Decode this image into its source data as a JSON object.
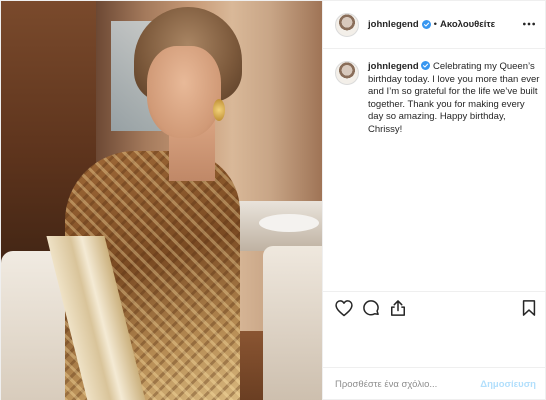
{
  "header": {
    "username": "johnlegend",
    "follow_label": "Ακολουθείτε"
  },
  "caption": {
    "username": "johnlegend",
    "text": "Celebrating my Queen’s birthday today. I love you more than ever and I’m so grateful for the life we’ve built together. Thank you for making every day so amazing. Happy birthday, Chrissy!"
  },
  "actions": {
    "icons": [
      "heart-icon",
      "comment-icon",
      "share-icon",
      "bookmark-icon"
    ],
    "more_icon": "more-options-icon"
  },
  "comment": {
    "placeholder": "Προσθέστε ένα σχόλιο...",
    "post_label": "Δημοσίευση"
  },
  "colors": {
    "verified": "#3897f0",
    "post_disabled": "#b2dffc",
    "text": "#262626",
    "muted": "#8e8e8e",
    "border": "#efefef"
  }
}
